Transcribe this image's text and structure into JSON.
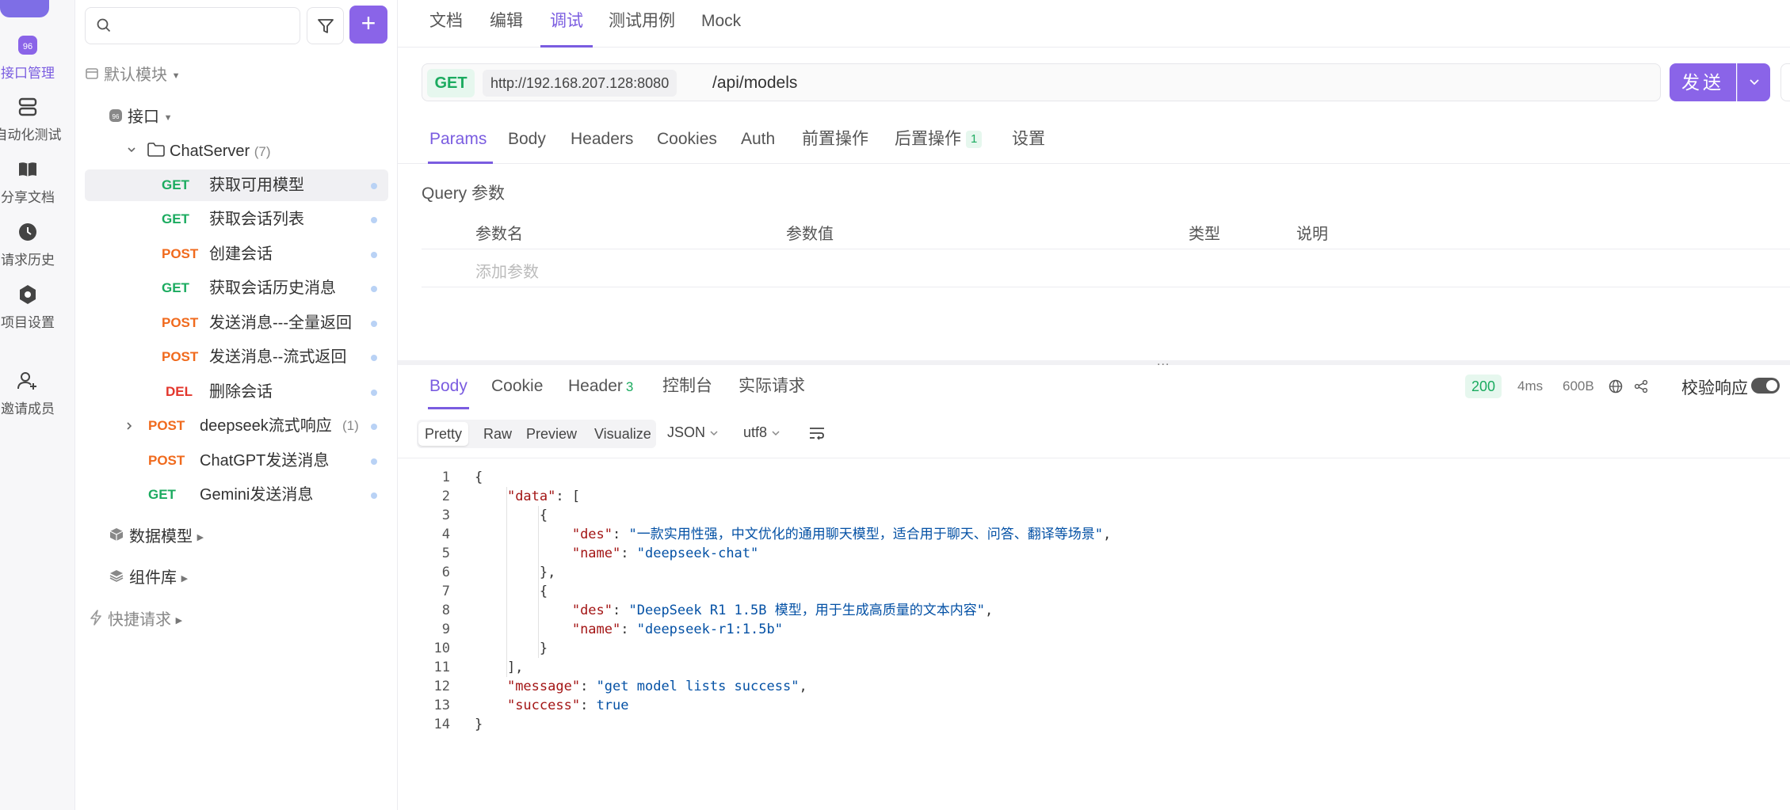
{
  "rail": {
    "items": [
      {
        "label": "接口管理",
        "icon": "api-icon",
        "active": true
      },
      {
        "label": "自动化测试",
        "icon": "automation-icon"
      },
      {
        "label": "分享文档",
        "icon": "book-icon"
      },
      {
        "label": "请求历史",
        "icon": "clock-icon"
      },
      {
        "label": "项目设置",
        "icon": "settings-icon"
      },
      {
        "label": "邀请成员",
        "icon": "add-user-icon"
      }
    ]
  },
  "tree": {
    "search_placeholder": "",
    "add_label": "+",
    "default_module": "默认模块",
    "api_root": "接口",
    "folder": {
      "name": "ChatServer",
      "count": "(7)"
    },
    "items": [
      {
        "method": "GET",
        "name": "获取可用模型",
        "selected": true
      },
      {
        "method": "GET",
        "name": "获取会话列表"
      },
      {
        "method": "POST",
        "name": "创建会话"
      },
      {
        "method": "GET",
        "name": "获取会话历史消息"
      },
      {
        "method": "POST",
        "name": "发送消息---全量返回"
      },
      {
        "method": "POST",
        "name": "发送消息--流式返回"
      },
      {
        "method": "DEL",
        "name": "删除会话"
      }
    ],
    "outer_items": [
      {
        "method": "POST",
        "name": "deepseek流式响应",
        "count": "(1)"
      },
      {
        "method": "POST",
        "name": "ChatGPT发送消息"
      },
      {
        "method": "GET",
        "name": "Gemini发送消息"
      }
    ],
    "data_model": "数据模型",
    "components": "组件库",
    "quick_request": "快捷请求"
  },
  "top_tabs": [
    {
      "label": "文档"
    },
    {
      "label": "编辑"
    },
    {
      "label": "调试",
      "active": true
    },
    {
      "label": "测试用例"
    },
    {
      "label": "Mock"
    }
  ],
  "request": {
    "method": "GET",
    "host": "http://192.168.207.128:8080",
    "path": "/api/models",
    "send_label": "发送"
  },
  "request_tabs": [
    {
      "label": "Params",
      "active": true
    },
    {
      "label": "Body"
    },
    {
      "label": "Headers"
    },
    {
      "label": "Cookies"
    },
    {
      "label": "Auth"
    },
    {
      "label": "前置操作"
    },
    {
      "label": "后置操作",
      "badge": "1"
    },
    {
      "label": "设置"
    }
  ],
  "query": {
    "title": "Query 参数",
    "columns": [
      "参数名",
      "参数值",
      "类型",
      "说明"
    ],
    "add_placeholder": "添加参数"
  },
  "split_handle": "...",
  "response_tabs": [
    {
      "label": "Body",
      "active": true
    },
    {
      "label": "Cookie"
    },
    {
      "label": "Header",
      "badge": "3"
    },
    {
      "label": "控制台"
    },
    {
      "label": "实际请求"
    }
  ],
  "response_meta": {
    "status": "200",
    "time": "4ms",
    "size": "600B",
    "validate_label": "校验响应",
    "validate_on": true
  },
  "view_modes": [
    "Pretty",
    "Raw",
    "Preview",
    "Visualize"
  ],
  "format": "JSON",
  "encoding": "utf8",
  "code_lines": [
    {
      "n": "1",
      "html": "{"
    },
    {
      "n": "2",
      "html": "    <span class=\"k\">\"data\"</span>: ["
    },
    {
      "n": "3",
      "html": "        {"
    },
    {
      "n": "4",
      "html": "            <span class=\"k\">\"des\"</span>: <span class=\"s\">\"一款实用性强，中文优化的通用聊天模型，适合用于聊天、问答、翻译等场景\"</span>,"
    },
    {
      "n": "5",
      "html": "            <span class=\"k\">\"name\"</span>: <span class=\"s\">\"deepseek-chat\"</span>"
    },
    {
      "n": "6",
      "html": "        },"
    },
    {
      "n": "7",
      "html": "        {"
    },
    {
      "n": "8",
      "html": "            <span class=\"k\">\"des\"</span>: <span class=\"s\">\"DeepSeek R1 1.5B 模型，用于生成高质量的文本内容\"</span>,"
    },
    {
      "n": "9",
      "html": "            <span class=\"k\">\"name\"</span>: <span class=\"s\">\"deepseek-r1:1.5b\"</span>"
    },
    {
      "n": "10",
      "html": "        }"
    },
    {
      "n": "11",
      "html": "    ],"
    },
    {
      "n": "12",
      "html": "    <span class=\"k\">\"message\"</span>: <span class=\"s\">\"get model lists success\"</span>,"
    },
    {
      "n": "13",
      "html": "    <span class=\"k\">\"success\"</span>: <span class=\"b\">true</span>"
    },
    {
      "n": "14",
      "html": "}"
    }
  ],
  "colors": {
    "accent": "#8a64e8",
    "get": "#1bab5f",
    "post": "#f06a1d",
    "del": "#e3362c"
  }
}
